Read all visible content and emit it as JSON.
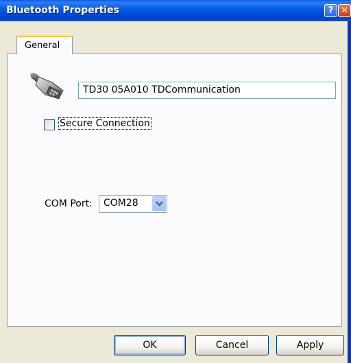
{
  "window": {
    "title": "Bluetooth Properties",
    "help_symbol": "?",
    "close_symbol": "✕"
  },
  "tabs": [
    {
      "label": "General",
      "selected": true
    }
  ],
  "device": {
    "icon": "serial-port-plug-icon",
    "name": "TD30  05A010 TDCommunication"
  },
  "secure_connection": {
    "label": "Secure Connection",
    "checked": false
  },
  "com_port": {
    "label": "COM Port:",
    "value": "COM28"
  },
  "buttons": {
    "ok": "OK",
    "cancel": "Cancel",
    "apply": "Apply"
  },
  "colors": {
    "titlebar": "#0058E6",
    "dialog_face": "#ECE9D8",
    "panel": "#FCFCFE",
    "tab_highlight": "#FFC83C"
  }
}
